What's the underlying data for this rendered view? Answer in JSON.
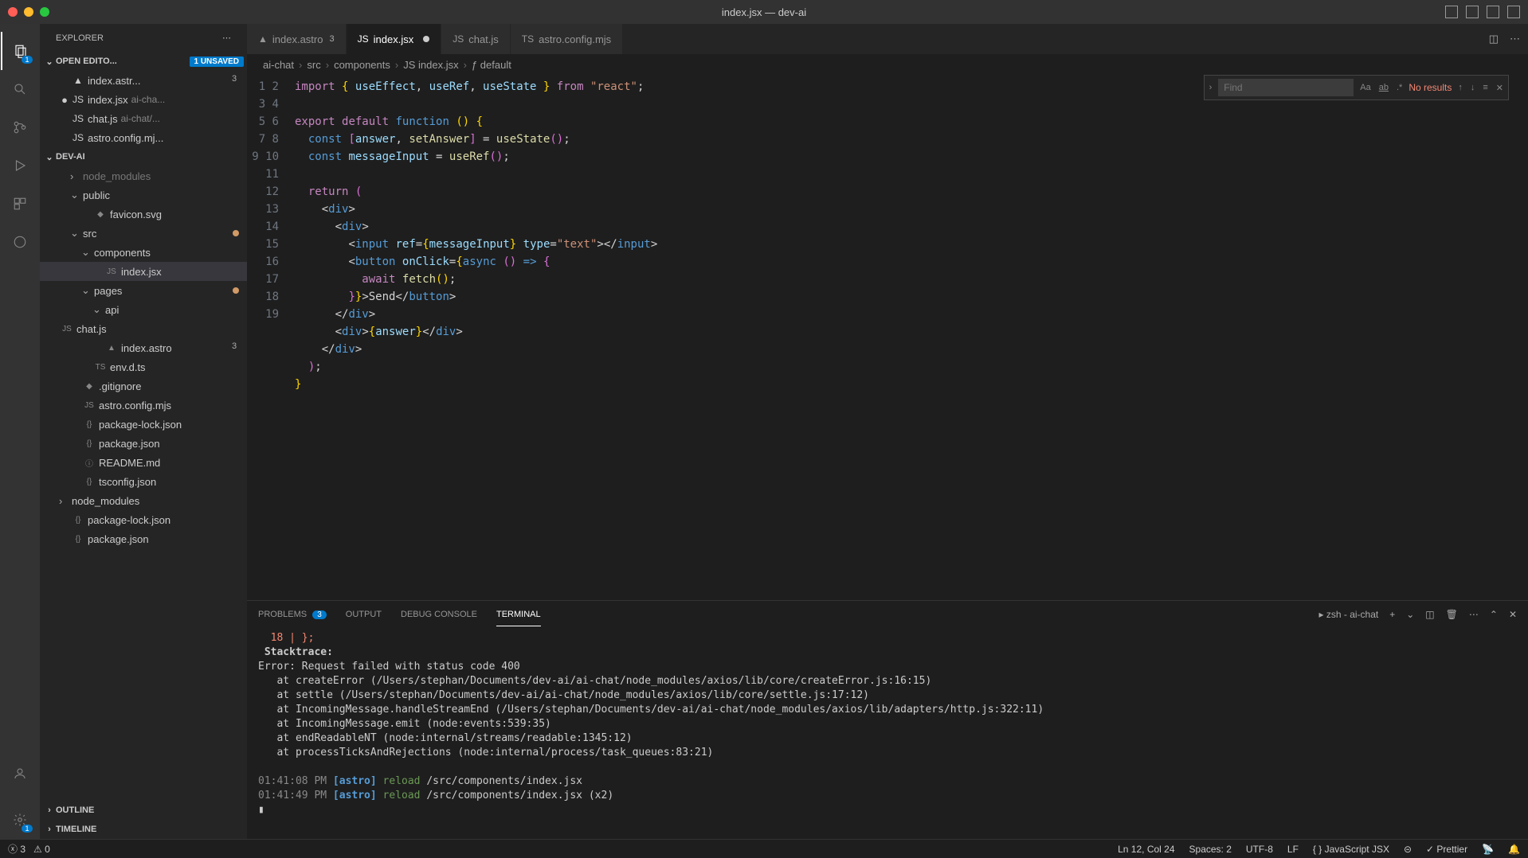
{
  "window": {
    "title": "index.jsx — dev-ai"
  },
  "sidebar": {
    "title": "EXPLORER",
    "openEditors": {
      "label": "OPEN EDITO...",
      "unsaved": "1 unsaved",
      "items": [
        {
          "name": "index.astr...",
          "badge": "3",
          "icon": "▲"
        },
        {
          "name": "index.jsx",
          "suffix": "ai-cha...",
          "dirty": true,
          "icon": "JS"
        },
        {
          "name": "chat.js",
          "suffix": "ai-chat/...",
          "icon": "JS"
        },
        {
          "name": "astro.config.mj...",
          "icon": "JS"
        }
      ]
    },
    "project": {
      "label": "DEV-AI",
      "tree": [
        {
          "name": "node_modules",
          "indent": 1,
          "chev": "›",
          "dim": true
        },
        {
          "name": "public",
          "indent": 1,
          "chev": "⌄"
        },
        {
          "name": "favicon.svg",
          "indent": 2,
          "icon": "◆"
        },
        {
          "name": "src",
          "indent": 1,
          "chev": "⌄",
          "mod": true
        },
        {
          "name": "components",
          "indent": 2,
          "chev": "⌄"
        },
        {
          "name": "index.jsx",
          "indent": 3,
          "icon": "JS",
          "active": true
        },
        {
          "name": "pages",
          "indent": 2,
          "chev": "⌄",
          "mod": true
        },
        {
          "name": "api",
          "indent": 3,
          "chev": "⌄"
        },
        {
          "name": "chat.js",
          "indent": 4,
          "icon": "JS"
        },
        {
          "name": "index.astro",
          "indent": 3,
          "icon": "▲",
          "badge": "3"
        },
        {
          "name": "env.d.ts",
          "indent": 2,
          "icon": "TS"
        },
        {
          "name": ".gitignore",
          "indent": 1,
          "icon": "◆"
        },
        {
          "name": "astro.config.mjs",
          "indent": 1,
          "icon": "JS"
        },
        {
          "name": "package-lock.json",
          "indent": 1,
          "icon": "{}"
        },
        {
          "name": "package.json",
          "indent": 1,
          "icon": "{}"
        },
        {
          "name": "README.md",
          "indent": 1,
          "icon": "ⓘ"
        },
        {
          "name": "tsconfig.json",
          "indent": 1,
          "icon": "{}"
        },
        {
          "name": "node_modules",
          "indent": 0,
          "chev": "›"
        },
        {
          "name": "package-lock.json",
          "indent": 0,
          "icon": "{}"
        },
        {
          "name": "package.json",
          "indent": 0,
          "icon": "{}"
        }
      ],
      "outline": "OUTLINE",
      "timeline": "TIMELINE"
    }
  },
  "tabs": [
    {
      "name": "index.astro",
      "icon": "▲",
      "badge": "3"
    },
    {
      "name": "index.jsx",
      "icon": "JS",
      "active": true,
      "dirty": true
    },
    {
      "name": "chat.js",
      "icon": "JS"
    },
    {
      "name": "astro.config.mjs",
      "icon": "TS"
    }
  ],
  "breadcrumb": [
    {
      "label": "ai-chat"
    },
    {
      "label": "src"
    },
    {
      "label": "components"
    },
    {
      "label": "index.jsx",
      "icon": "JS"
    },
    {
      "label": "default",
      "icon": "ƒ"
    }
  ],
  "find": {
    "placeholder": "Find",
    "result": "No results"
  },
  "editor": {
    "lines": [
      1,
      2,
      3,
      4,
      5,
      6,
      7,
      8,
      9,
      10,
      11,
      12,
      13,
      14,
      15,
      16,
      17,
      18,
      19
    ]
  },
  "panel": {
    "tabs": {
      "problems": "PROBLEMS",
      "problemsBadge": "3",
      "output": "OUTPUT",
      "debug": "DEBUG CONSOLE",
      "terminal": "TERMINAL"
    },
    "shell": "zsh - ai-chat",
    "terminal": {
      "line1_pre": "  18 | };",
      "stack": "Stacktrace:",
      "err": "Error: Request failed with status code 400",
      "at": [
        "   at createError (/Users/stephan/Documents/dev-ai/ai-chat/node_modules/axios/lib/core/createError.js:16:15)",
        "   at settle (/Users/stephan/Documents/dev-ai/ai-chat/node_modules/axios/lib/core/settle.js:17:12)",
        "   at IncomingMessage.handleStreamEnd (/Users/stephan/Documents/dev-ai/ai-chat/node_modules/axios/lib/adapters/http.js:322:11)",
        "   at IncomingMessage.emit (node:events:539:35)",
        "   at endReadableNT (node:internal/streams/readable:1345:12)",
        "   at processTicksAndRejections (node:internal/process/task_queues:83:21)"
      ],
      "r1_ts": "01:41:08 PM",
      "r1_tag": "[astro]",
      "r1_act": "reload",
      "r1_path": "/src/components/index.jsx",
      "r2_ts": "01:41:49 PM",
      "r2_tag": "[astro]",
      "r2_act": "reload",
      "r2_path": "/src/components/index.jsx (x2)",
      "cursor": "▮"
    }
  },
  "status": {
    "errors": "3",
    "warnings": "0",
    "cursor": "Ln 12, Col 24",
    "spaces": "Spaces: 2",
    "encoding": "UTF-8",
    "eol": "LF",
    "lang": "{ } JavaScript JSX",
    "prettier": "✓ Prettier"
  },
  "activity": {
    "explorerBadge": "1",
    "settingsBadge": "1"
  }
}
